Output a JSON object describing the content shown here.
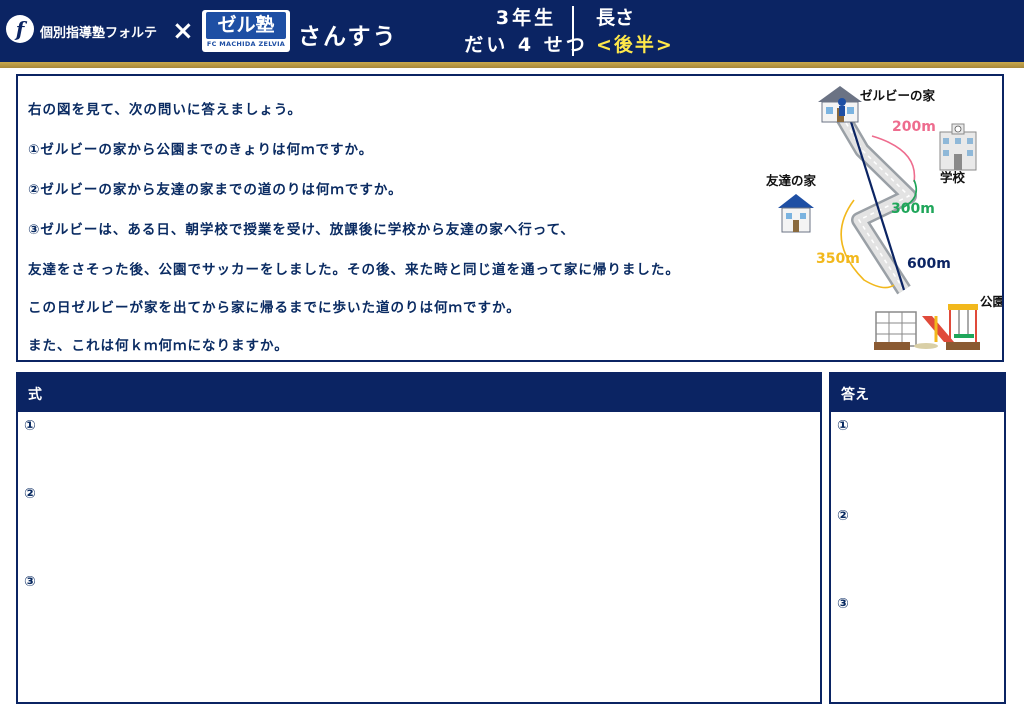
{
  "header": {
    "brand_logo_letter": "f",
    "brand_name": "個別指導塾フォルテ",
    "cross": "×",
    "zel_logo_main": "ゼル塾",
    "zel_logo_sub": "FC MACHIDA ZELVIA",
    "subject": "さんすう",
    "grade_line1": "3年生",
    "grade_line2": "だい 4 せつ",
    "topic_line1": "長さ",
    "topic_line2": "<後半>"
  },
  "colors": {
    "navy": "#0b2463",
    "gold": "#c9a94d",
    "yellow": "#ffe84a",
    "pink": "#ee6c8e",
    "green": "#1fa65a",
    "orange": "#f2b81c"
  },
  "question": {
    "lines": [
      "右の図を見て、次の問いに答えましょう。",
      "①ゼルビーの家から公園までのきょりは何ｍですか。",
      "②ゼルビーの家から友達の家までの道のりは何ｍですか。",
      "③ゼルビーは、ある日、朝学校で授業を受け、放課後に学校から友達の家へ行って、",
      "友達をさそった後、公園でサッカーをしました。その後、来た時と同じ道を通って家に帰りました。",
      "この日ゼルビーが家を出てから家に帰るまでに歩いた道のりは何ｍですか。",
      "また、これは何ｋｍ何ｍになりますか。"
    ]
  },
  "map": {
    "zelby_house": "ゼルビーの家",
    "school": "学校",
    "friend_house": "友達の家",
    "park": "公園",
    "dist_house_school": "200m",
    "dist_school_friend": "300m",
    "dist_friend_park": "350m",
    "dist_house_park": "600m",
    "icons": [
      "house-icon",
      "school-icon",
      "friend-house-icon",
      "playground-icon"
    ]
  },
  "work": {
    "formula_title": "式",
    "answer_title": "答え",
    "marks": [
      "①",
      "②",
      "③"
    ]
  }
}
